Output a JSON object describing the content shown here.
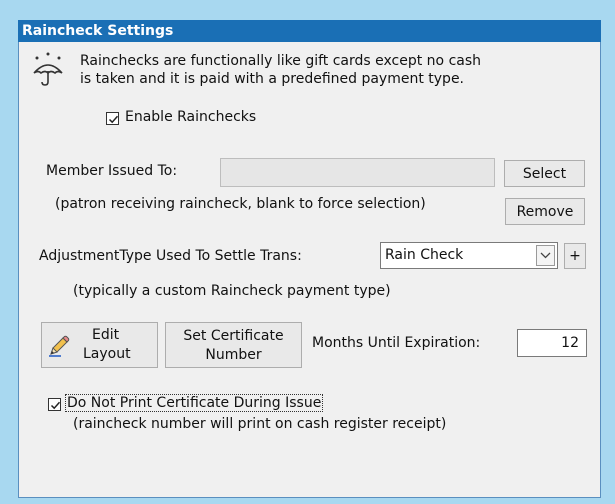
{
  "panel": {
    "title": "Raincheck Settings",
    "description_line1": "Rainchecks are functionally like gift cards except no cash",
    "description_line2": "is taken and it is paid with a predefined payment type.",
    "icon": "umbrella-icon",
    "enable": {
      "label": "Enable Rainchecks",
      "checked": true
    }
  },
  "member": {
    "label": "Member Issued To:",
    "value": "",
    "select_label": "Select",
    "remove_label": "Remove",
    "hint": "(patron receiving raincheck, blank to force selection)"
  },
  "adjustment": {
    "label": "AdjustmentType Used To Settle Trans:",
    "selected": "Rain Check",
    "add_label": "+",
    "hint": "(typically a custom Raincheck payment type)"
  },
  "layout": {
    "edit_line1": "Edit",
    "edit_line2": "Layout",
    "edit_icon": "pencil-icon",
    "cert_line1": "Set Certificate",
    "cert_line2": "Number",
    "months_label": "Months Until Expiration:",
    "months_value": "12"
  },
  "print": {
    "label": "Do Not Print Certificate During Issue",
    "checked": true,
    "hint": "(raincheck number will print on cash register receipt)"
  },
  "colors": {
    "title_bg": "#1a6fb5",
    "outer_bg": "#a8d8f0",
    "panel_bg": "#f0f0f0"
  }
}
